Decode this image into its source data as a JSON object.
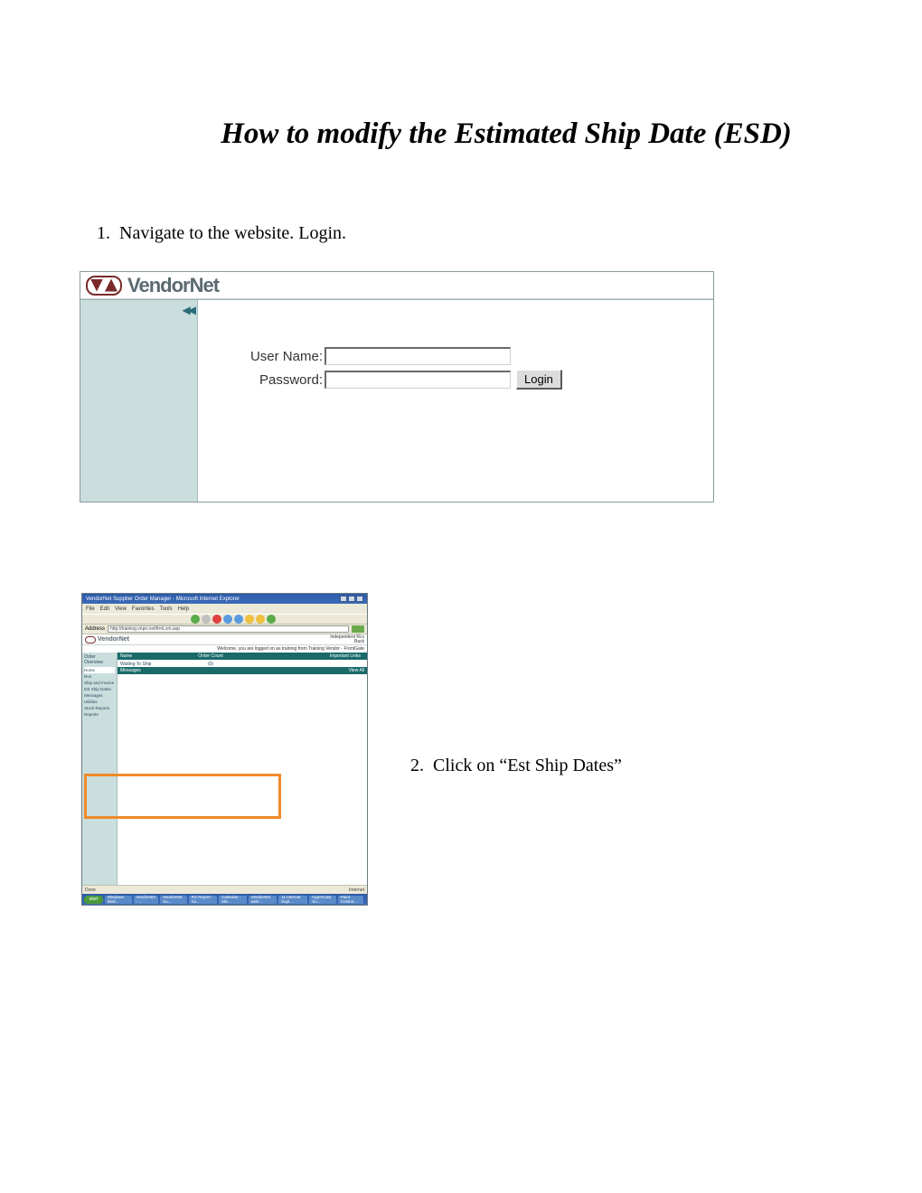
{
  "title": "How to modify the Estimated Ship Date (ESD)",
  "steps": {
    "s1_num": "1.",
    "s1_text": "Navigate to the website. Login.",
    "s2_num": "2.",
    "s2_text": "Click on “Est Ship Dates”"
  },
  "shot1": {
    "brand": "VendorNet",
    "collapse_glyph": "◀◀",
    "username_label": "User Name:",
    "password_label": "Password:",
    "login_button": "Login"
  },
  "shot2": {
    "window_title": "VendorNet Supplier Order Manager - Microsoft Internet Explorer",
    "menu": [
      "File",
      "Edit",
      "View",
      "Favorites",
      "Tools",
      "Help"
    ],
    "address_label": "Address",
    "address_value": "http://training.vnpn.net/frmLvm.asp",
    "brand": "VendorNet",
    "header_right_top": "Independent Rcv",
    "header_right_bottom": "Back",
    "welcome": "Welcome, you are logged on as training from Training Vendor - FrontGate",
    "sidebar_title": "Order Overview",
    "sidebar_items": [
      "Home",
      "Run",
      "Ship and Invoice",
      "Est Ship Dates",
      "Messages",
      "Utilities",
      "Stock Reports",
      "Reports"
    ],
    "table_hdr_name": "Name",
    "table_hdr_count": "Order Count",
    "table_hdr_important": "Important Links",
    "row1_name": "Waiting To Ship",
    "row1_count": "(0)",
    "msgs_label": "Messages",
    "msgs_view": "View All",
    "status_done": "Done",
    "status_right": "Internet",
    "taskbar_start": "start",
    "taskbar_items": [
      "Windows Med...",
      "VendorNet - ...",
      "VendorNet Su...",
      "RX Report - Su...",
      "Calendar - Mic...",
      "VendorNet web...",
      "11 Internet Expl...",
      "HyperCast Su...",
      "Paint Control..."
    ]
  }
}
